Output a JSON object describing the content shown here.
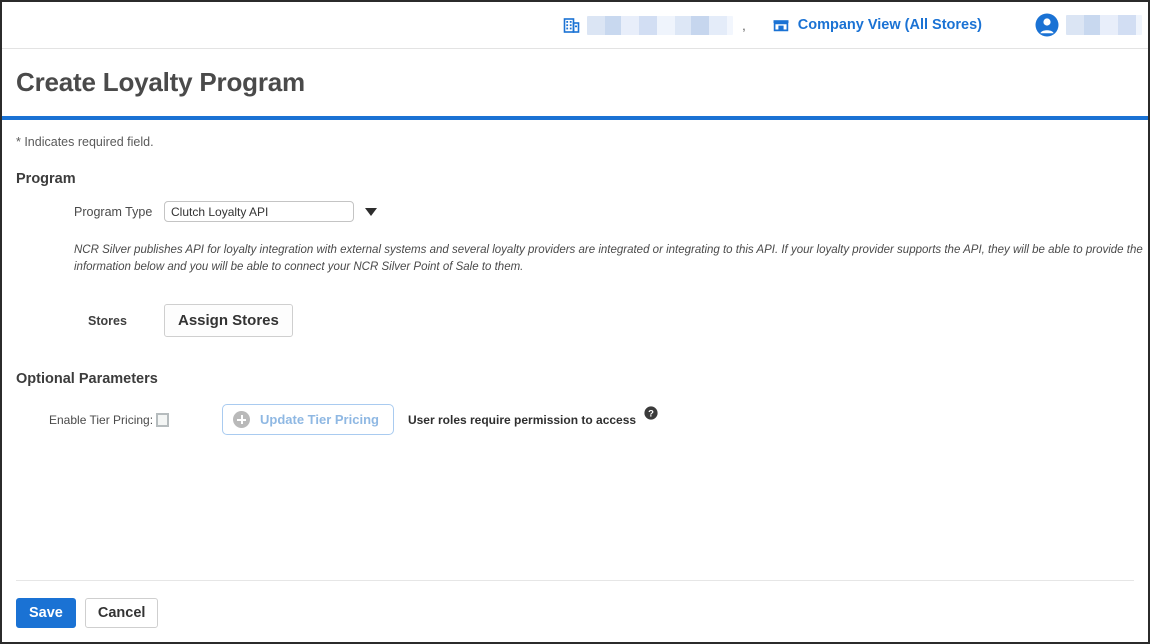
{
  "colors": {
    "accent_blue": "#1a72d4",
    "title_gray": "#4a4a4a",
    "border_dark": "#2b2b2b",
    "tier_button_blue": "#8fb8e3"
  },
  "header": {
    "company_icon": "building-icon",
    "company_name_redacted": "",
    "comma": ",",
    "store_icon": "storefront-icon",
    "store_view_label": "Company View (All Stores)",
    "avatar_icon": "user-avatar-icon",
    "user_name_redacted": ""
  },
  "page": {
    "title": "Create Loyalty Program",
    "required_note": "* Indicates required field."
  },
  "program": {
    "section_title": "Program",
    "program_type_label": "Program Type",
    "program_type_value": "Clutch Loyalty API",
    "program_type_options": [
      "Clutch Loyalty API"
    ],
    "dropdown_icon": "chevron-down-icon",
    "api_note": "NCR Silver publishes API for loyalty integration with external systems and several loyalty providers are integrated or integrating to this API. If your loyalty provider supports the API, they will be able to provide the information below and you will be able to connect your NCR Silver Point of Sale to them.",
    "stores_label": "Stores",
    "assign_stores_button": "Assign Stores"
  },
  "optional_parameters": {
    "section_title": "Optional Parameters",
    "enable_tier_pricing_label": "Enable Tier Pricing:",
    "enable_tier_pricing_checked": false,
    "update_tier_pricing_button": "Update Tier Pricing",
    "plus_icon": "plus-circle-icon",
    "permission_text": "User roles require permission to access",
    "help_icon": "help-circle-icon"
  },
  "footer": {
    "save_label": "Save",
    "cancel_label": "Cancel"
  }
}
